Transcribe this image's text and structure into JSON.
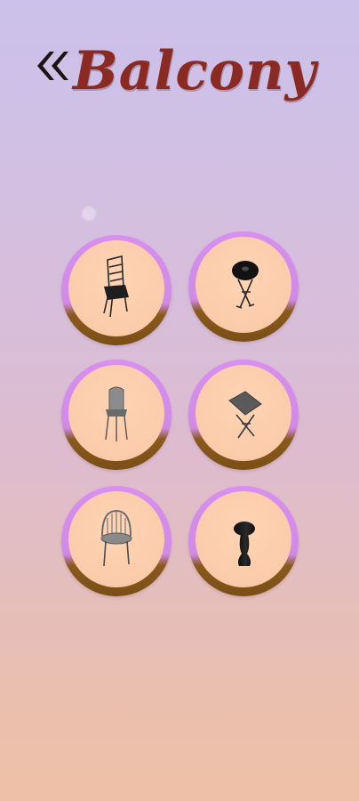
{
  "header": {
    "back_icon": "double-chevron-left-icon",
    "title": "Balcony"
  },
  "colors": {
    "title": "#8b2a22",
    "ring_top": "#d88ff0",
    "ring_bottom": "#7a4e16",
    "circle_fill": "#ffd4b4"
  },
  "items": [
    {
      "icon": "folding-bistro-chair-icon"
    },
    {
      "icon": "round-bistro-table-icon"
    },
    {
      "icon": "tall-bar-chair-icon"
    },
    {
      "icon": "square-folding-table-icon"
    },
    {
      "icon": "spindle-back-chair-icon"
    },
    {
      "icon": "pedestal-side-table-icon"
    }
  ]
}
